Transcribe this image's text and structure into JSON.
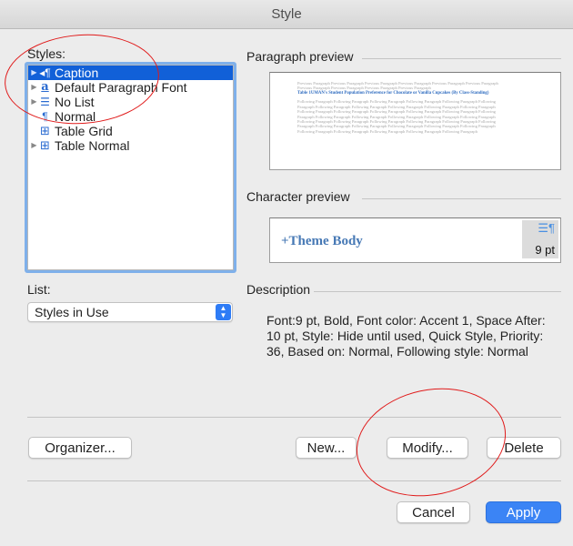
{
  "window": {
    "title": "Style"
  },
  "styles": {
    "label": "Styles:",
    "items": [
      {
        "label": "Caption",
        "icon": "caption-paragraph-icon",
        "expandable": true,
        "selected": true
      },
      {
        "label": "Default Paragraph Font",
        "icon": "character-style-icon",
        "expandable": true,
        "selected": false
      },
      {
        "label": "No List",
        "icon": "list-style-icon",
        "expandable": true,
        "selected": false
      },
      {
        "label": "Normal",
        "icon": "paragraph-style-icon",
        "expandable": false,
        "selected": false
      },
      {
        "label": "Table Grid",
        "icon": "table-style-icon",
        "expandable": false,
        "selected": false
      },
      {
        "label": "Table Normal",
        "icon": "table-style-icon",
        "expandable": true,
        "selected": false
      }
    ]
  },
  "paragraph_preview": {
    "label": "Paragraph preview",
    "previous_lines": [
      "Previous Paragraph Previous Paragraph Previous Paragraph Previous Paragraph Previous Paragraph Previous Paragraph",
      "Previous Paragraph Previous Paragraph Previous Paragraph Previous Paragraph"
    ],
    "caption_line": "Table 1UMAN's Student Population Preference for Chocolate or Vanilla Cupcakes (By Class-Standing)",
    "following_lines": [
      "Following Paragraph Following Paragraph Following Paragraph Following Paragraph Following Paragraph Following",
      "Paragraph Following Paragraph Following Paragraph Following Paragraph Following Paragraph Following Paragraph",
      "Following Paragraph Following Paragraph Following Paragraph Following Paragraph Following Paragraph Following",
      "Paragraph Following Paragraph Following Paragraph Following Paragraph Following Paragraph Following Paragraph",
      "Following Paragraph Following Paragraph Following Paragraph Following Paragraph Following Paragraph Following",
      "Paragraph Following Paragraph Following Paragraph Following Paragraph Following Paragraph Following Paragraph",
      "Following Paragraph Following Paragraph Following Paragraph Following Paragraph Following Paragraph"
    ]
  },
  "character_preview": {
    "label": "Character preview",
    "sample": "+Theme Body",
    "size": "9 pt"
  },
  "list": {
    "label": "List:",
    "selected": "Styles in Use"
  },
  "description": {
    "label": "Description",
    "text": "Font:9 pt, Bold, Font color: Accent 1, Space After: 10 pt, Style: Hide until used, Quick Style, Priority: 36, Based on: Normal, Following style: Normal"
  },
  "buttons": {
    "organizer": "Organizer...",
    "new": "New...",
    "modify": "Modify...",
    "delete": "Delete",
    "cancel": "Cancel",
    "apply": "Apply"
  },
  "colors": {
    "selection": "#1160d8",
    "accent": "#3b84f5",
    "annotation": "#e01a1a"
  }
}
